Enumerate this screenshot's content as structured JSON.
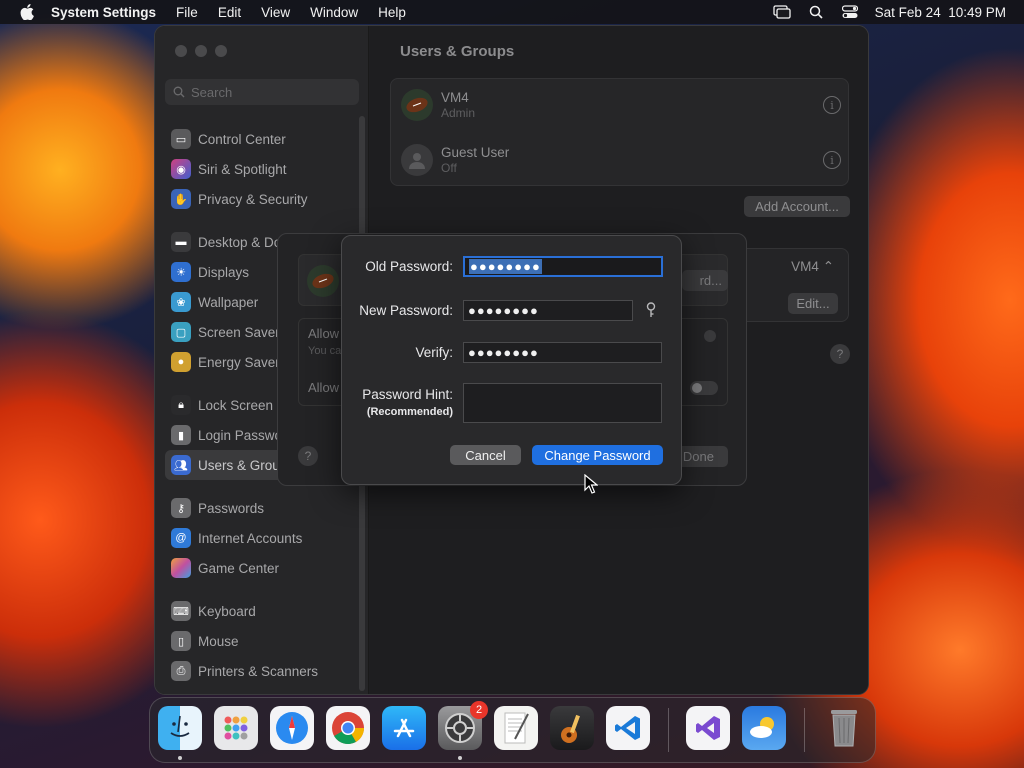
{
  "menubar": {
    "app_name": "System Settings",
    "menus": [
      "File",
      "Edit",
      "View",
      "Window",
      "Help"
    ],
    "datetime": "Sat Feb 24  10:49 PM"
  },
  "sidebar": {
    "search_placeholder": "Search",
    "items": [
      {
        "label": "Control Center",
        "icon": "control-center-icon",
        "color": "#5a5a5c"
      },
      {
        "label": "Siri & Spotlight",
        "icon": "siri-icon",
        "color": "#b03a8a"
      },
      {
        "label": "Privacy & Security",
        "icon": "hand-icon",
        "color": "#3a64b8"
      },
      {
        "label": "Desktop & Do",
        "icon": "desktop-icon",
        "color": "#3a3a3c"
      },
      {
        "label": "Displays",
        "icon": "sun-icon",
        "color": "#2f6fd0"
      },
      {
        "label": "Wallpaper",
        "icon": "flower-icon",
        "color": "#3a9ad0"
      },
      {
        "label": "Screen Saver",
        "icon": "screen-saver-icon",
        "color": "#3aa0c0"
      },
      {
        "label": "Energy Saver",
        "icon": "bulb-icon",
        "color": "#d0a030"
      },
      {
        "label": "Lock Screen",
        "icon": "lock-icon",
        "color": "#2a2a2c"
      },
      {
        "label": "Login Passwo",
        "icon": "login-icon",
        "color": "#6a6a6c"
      },
      {
        "label": "Users & Grou",
        "icon": "users-icon",
        "color": "#3a6ad0"
      },
      {
        "label": "Passwords",
        "icon": "key-icon",
        "color": "#6a6a6c"
      },
      {
        "label": "Internet Accounts",
        "icon": "at-icon",
        "color": "#2f7ad8"
      },
      {
        "label": "Game Center",
        "icon": "game-center-icon",
        "color": "#c050a0"
      },
      {
        "label": "Keyboard",
        "icon": "keyboard-icon",
        "color": "#6a6a6c"
      },
      {
        "label": "Mouse",
        "icon": "mouse-icon",
        "color": "#6a6a6c"
      },
      {
        "label": "Printers & Scanners",
        "icon": "printer-icon",
        "color": "#6a6a6c"
      }
    ]
  },
  "main": {
    "title": "Users & Groups",
    "users": [
      {
        "name": "VM4",
        "role": "Admin"
      },
      {
        "name": "Guest User",
        "role": "Off"
      }
    ],
    "add_account_label": "Add Account...",
    "panel_value": "VM4",
    "edit_label": "Edit..."
  },
  "sheet_bg": {
    "allow1": "Allow",
    "allow1_sub": "You ca",
    "allow2": "Allow",
    "pw_button": "rd...",
    "done_label": "Done"
  },
  "dialog": {
    "old_password_label": "Old Password:",
    "old_password_value": "●●●●●●●●",
    "new_password_label": "New Password:",
    "new_password_value": "●●●●●●●●",
    "verify_label": "Verify:",
    "verify_value": "●●●●●●●●",
    "hint_label": "Password Hint:",
    "hint_sub": "(Recommended)",
    "hint_value": "",
    "cancel_label": "Cancel",
    "change_label": "Change Password"
  },
  "dock": {
    "apps": [
      "finder",
      "launchpad",
      "safari",
      "chrome",
      "app-store",
      "system-settings",
      "textedit",
      "garageband",
      "vscode",
      "visual-studio",
      "weather",
      "trash"
    ],
    "settings_badge": "2"
  }
}
